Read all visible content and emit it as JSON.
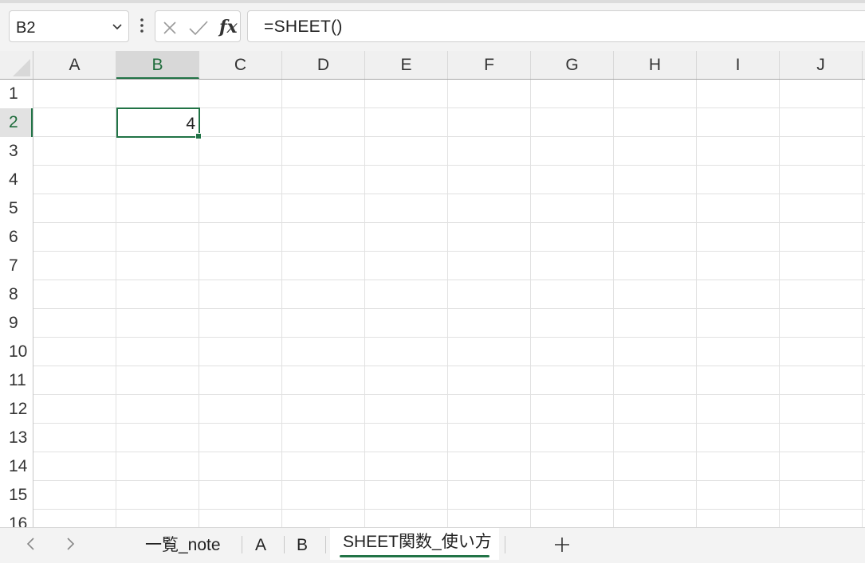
{
  "formula_bar": {
    "name_box": "B2",
    "formula": "=SHEET()",
    "fx_label": "fx"
  },
  "columns": [
    "A",
    "B",
    "C",
    "D",
    "E",
    "F",
    "G",
    "H",
    "I",
    "J"
  ],
  "rows": [
    "1",
    "2",
    "3",
    "4",
    "5",
    "6",
    "7",
    "8",
    "9",
    "10",
    "11",
    "12",
    "13",
    "14",
    "15",
    "16"
  ],
  "selected_column": "B",
  "selected_row": "2",
  "active_cell": {
    "ref": "B2",
    "value": "4"
  },
  "sheet_tabs": [
    {
      "label": "一覧_note"
    },
    {
      "label": "A"
    },
    {
      "label": "B"
    },
    {
      "label": "SHEET関数_使い方"
    }
  ],
  "active_sheet": "SHEET関数_使い方",
  "icons": {
    "name_box_dropdown": "chevron-down-icon",
    "more": "vertical-dots-icon",
    "cancel": "close-icon",
    "enter": "check-icon",
    "insert_function": "fx-icon",
    "prev_sheet": "chevron-left-icon",
    "next_sheet": "chevron-right-icon",
    "new_sheet": "plus-icon"
  },
  "colors": {
    "accent": "#217346"
  }
}
